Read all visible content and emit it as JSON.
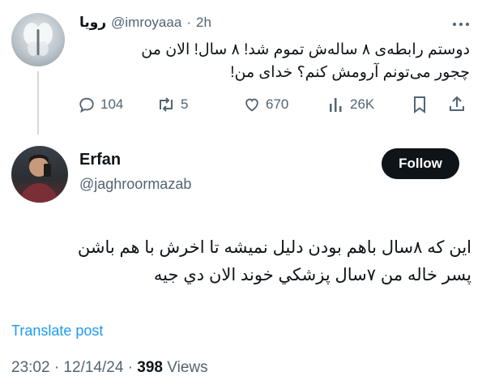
{
  "colors": {
    "accent": "#1d9bf0",
    "text": "#0f1419",
    "muted": "#536471",
    "thread_line": "#cfd9de"
  },
  "quoted_tweet": {
    "display_name": "رویا",
    "handle": "@imroyaaa",
    "dot": "·",
    "time": "2h",
    "text_line1": "دوستم رابطه‌ی ۸ ساله‌ش تموم شد! ۸ سال! الان من",
    "text_line2": "چجور می‌تونم آرومش کنم؟ خدای من!",
    "more_icon": "more-dots-icon",
    "actions": {
      "replies": "104",
      "reposts": "5",
      "likes": "670",
      "views": "26K"
    }
  },
  "reply_tweet": {
    "display_name": "Erfan",
    "handle": "@jaghroormazab",
    "follow_label": "Follow",
    "text_line1": "اين که ۸سال باهم بودن دليل نميشه تا اخرش با هم باشن",
    "text_line2": "پسر خاله من ۷سال پزشکي خوند الان دي جيه",
    "translate_label": "Translate post",
    "timestamp": "23:02 · 12/14/24 · ",
    "views_count": "398",
    "views_label": " Views"
  }
}
